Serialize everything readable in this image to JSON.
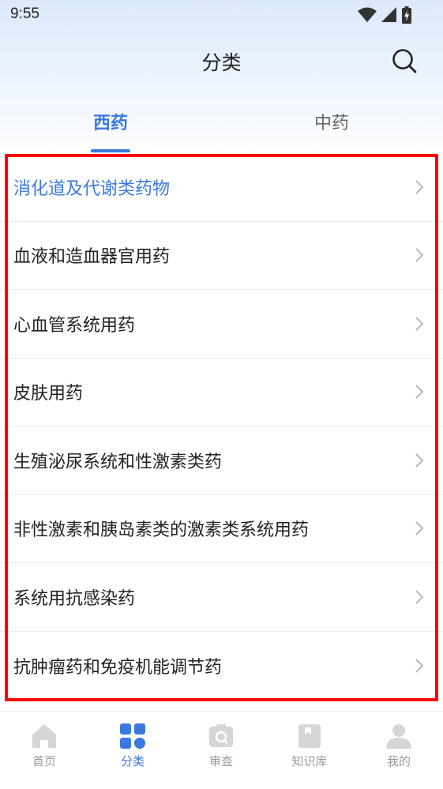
{
  "status_bar": {
    "time": "9:55"
  },
  "header": {
    "title": "分类"
  },
  "tabs": [
    {
      "label": "西药",
      "active": true
    },
    {
      "label": "中药",
      "active": false
    }
  ],
  "categories": [
    {
      "label": "消化道及代谢类药物",
      "active": true
    },
    {
      "label": "血液和造血器官用药",
      "active": false
    },
    {
      "label": "心血管系统用药",
      "active": false
    },
    {
      "label": "皮肤用药",
      "active": false
    },
    {
      "label": "生殖泌尿系统和性激素类药",
      "active": false
    },
    {
      "label": "非性激素和胰岛素类的激素类系统用药",
      "active": false
    },
    {
      "label": "系统用抗感染药",
      "active": false
    },
    {
      "label": "抗肿瘤药和免疫机能调节药",
      "active": false
    }
  ],
  "bottom_nav": [
    {
      "label": "首页",
      "icon": "home-icon",
      "active": false
    },
    {
      "label": "分类",
      "icon": "category-grid-icon",
      "active": true
    },
    {
      "label": "审查",
      "icon": "review-icon",
      "active": false
    },
    {
      "label": "知识库",
      "icon": "knowledge-book-icon",
      "active": false
    },
    {
      "label": "我的",
      "icon": "profile-icon",
      "active": false
    }
  ],
  "colors": {
    "accent": "#3a78e0",
    "highlight_border": "#ff0000",
    "inactive_icon": "#d6d6d6"
  }
}
